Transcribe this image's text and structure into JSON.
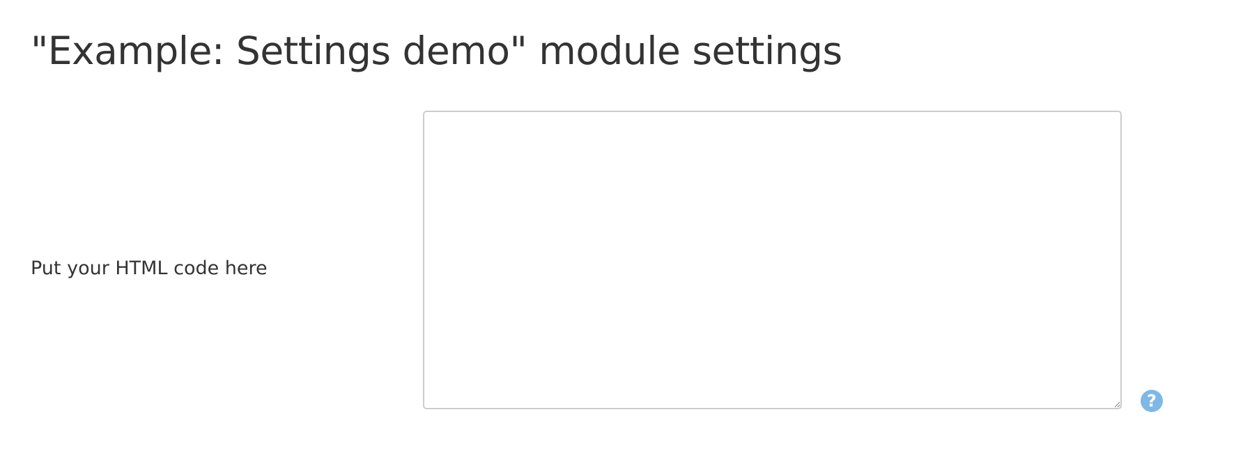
{
  "page": {
    "title": "\"Example: Settings demo\" module settings"
  },
  "form": {
    "html_field": {
      "label": "Put your HTML code here",
      "value": "",
      "placeholder": ""
    },
    "help_icon": {
      "glyph": "?",
      "icon": "question-circle-icon",
      "color": "#7fb8e6"
    }
  }
}
